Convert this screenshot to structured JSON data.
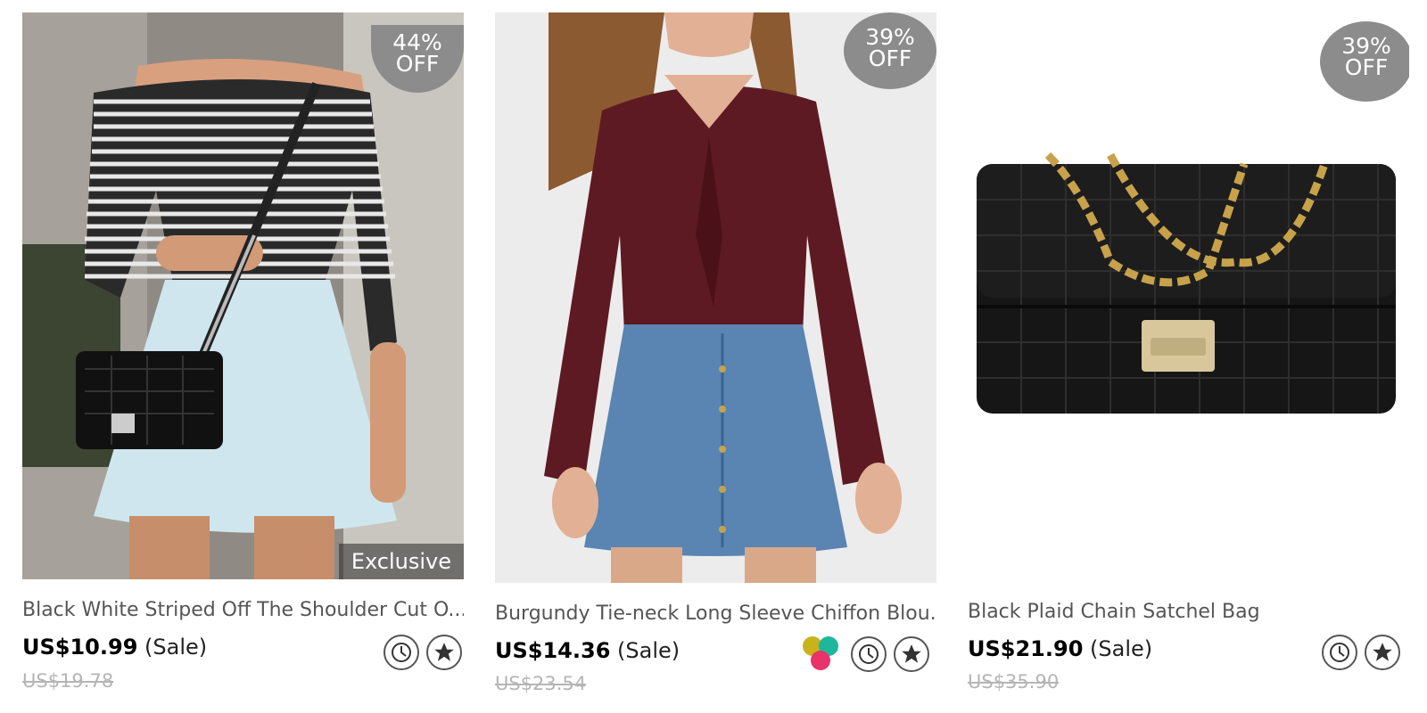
{
  "products": [
    {
      "discount_line1": "44%",
      "discount_line2": "OFF",
      "tag": "Exclusive",
      "title": "Black White Striped Off The Shoulder Cut O...",
      "price": "US$10.99",
      "price_note": "(Sale)",
      "old_price": "US$19.78",
      "image": "woman-striped-top-light-skirt-black-bag"
    },
    {
      "discount_line1": "39%",
      "discount_line2": "OFF",
      "title": "Burgundy Tie-neck Long Sleeve Chiffon Blou...",
      "price": "US$14.36",
      "price_note": "(Sale)",
      "old_price": "US$23.54",
      "image": "woman-burgundy-blouse-denim-skirt",
      "swatch_colors": [
        "#c9b21c",
        "#1fb79b",
        "#e8336b"
      ]
    },
    {
      "discount_line1": "39%",
      "discount_line2": "OFF",
      "title": "Black Plaid Chain Satchel Bag",
      "price": "US$21.90",
      "price_note": "(Sale)",
      "old_price": "US$35.90",
      "image": "black-quilted-chain-bag"
    }
  ],
  "icons": {
    "clock": "clock-icon",
    "favorite": "star-icon"
  }
}
